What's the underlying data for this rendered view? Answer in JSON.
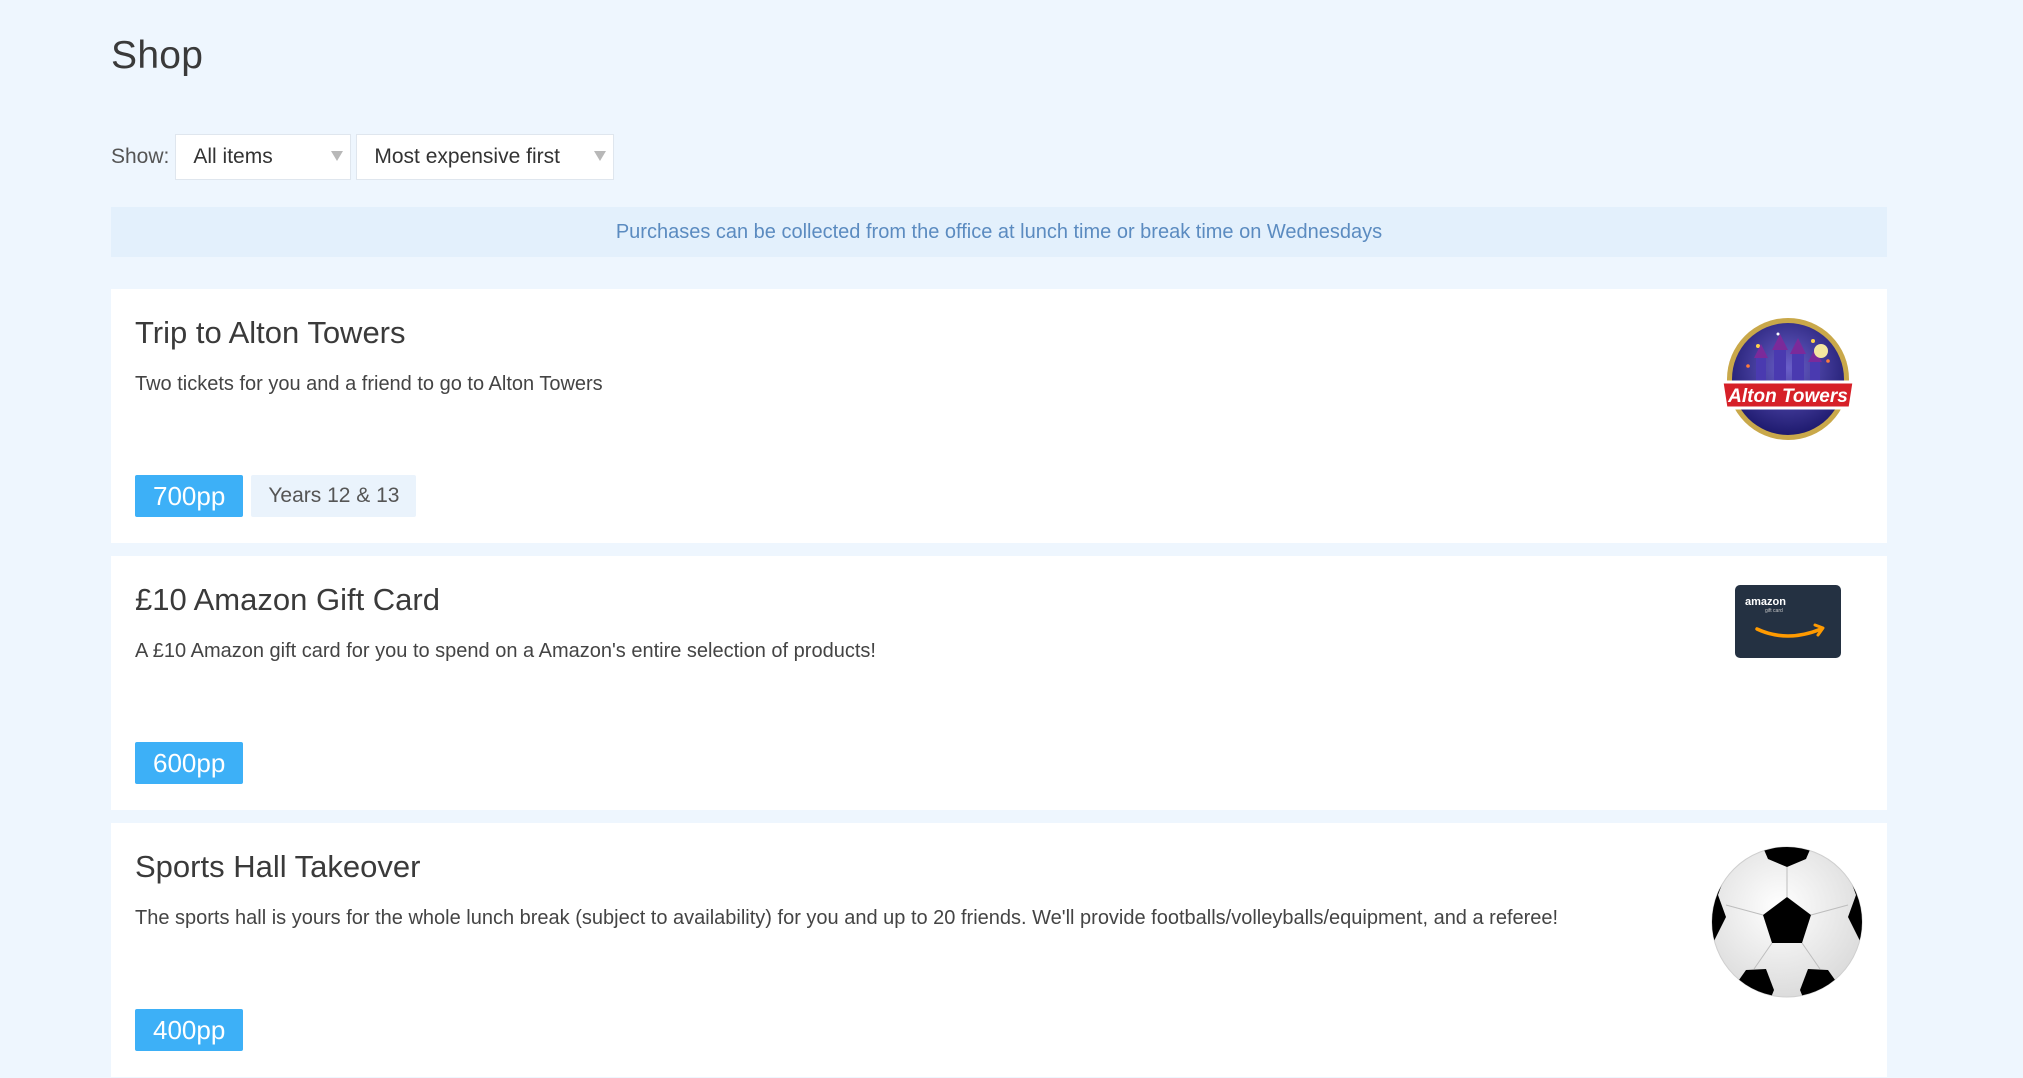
{
  "page": {
    "title": "Shop"
  },
  "filters": {
    "show_label": "Show:",
    "items_select": "All items",
    "sort_select": "Most expensive first"
  },
  "notice": "Purchases can be collected from the office at lunch time or break time on Wednesdays",
  "items": [
    {
      "title": "Trip to Alton Towers",
      "description": "Two tickets for you and a friend to go to Alton Towers",
      "price": "700pp",
      "years": "Years 12 & 13",
      "image_icon": "alton-towers-logo",
      "image_text": "Alton Towers"
    },
    {
      "title": "£10 Amazon Gift Card",
      "description": "A £10 Amazon gift card for you to spend on a Amazon's entire selection of products!",
      "price": "600pp",
      "image_icon": "amazon-gift-card",
      "image_text": "amazon",
      "image_subtext": "gift card"
    },
    {
      "title": "Sports Hall Takeover",
      "description": "The sports hall is yours for the whole lunch break (subject to availability) for you and up to 20 friends. We'll provide footballs/volleyballs/equipment, and a referee!",
      "price": "400pp",
      "image_icon": "football-icon"
    }
  ],
  "colors": {
    "background": "#eef6fe",
    "price_badge": "#3db0f7",
    "notice_text": "#5b8bc0",
    "notice_bg": "#e3f0fc"
  }
}
